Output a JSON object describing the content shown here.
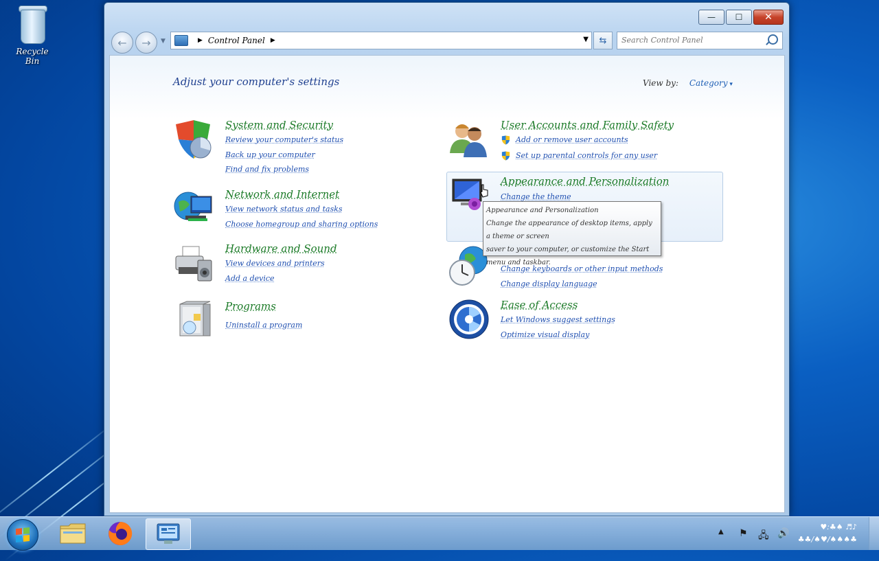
{
  "desktop": {
    "recycle_bin_label": "Recycle Bin"
  },
  "window": {
    "buttons": {
      "minimize": "—",
      "maximize": "☐",
      "close": "✕"
    },
    "address": {
      "crumb": "Control Panel"
    },
    "search": {
      "placeholder": "Search Control Panel"
    }
  },
  "content": {
    "heading": "Adjust your computer's settings",
    "view_by_label": "View by:",
    "view_by_value": "Category"
  },
  "categories": {
    "system": {
      "title": "System and Security",
      "links": [
        "Review your computer's status",
        "Back up your computer",
        "Find and fix problems"
      ]
    },
    "network": {
      "title": "Network and Internet",
      "links": [
        "View network status and tasks",
        "Choose homegroup and sharing options"
      ]
    },
    "hardware": {
      "title": "Hardware and Sound",
      "links": [
        "View devices and printers",
        "Add a device"
      ]
    },
    "programs": {
      "title": "Programs",
      "links": [
        "Uninstall a program"
      ]
    },
    "users": {
      "title": "User Accounts and Family Safety",
      "links": [
        "Add or remove user accounts",
        "Set up parental controls for any user"
      ]
    },
    "appearance": {
      "title": "Appearance and Personalization",
      "links": [
        "Change the theme"
      ]
    },
    "clock": {
      "links": [
        "Change keyboards or other input methods",
        "Change display language"
      ]
    },
    "ease": {
      "title": "Ease of Access",
      "links": [
        "Let Windows suggest settings",
        "Optimize visual display"
      ]
    }
  },
  "tooltip": {
    "title": "Appearance and Personalization",
    "line1": "Change the appearance of desktop items, apply a theme or screen",
    "line2": "saver to your computer, or customize the Start menu and taskbar."
  },
  "taskbar": {
    "items": [
      "start",
      "explorer",
      "firefox",
      "control-panel"
    ],
    "tray_icons": [
      "show-hidden-icons",
      "action-center-icon",
      "network-icon",
      "volume-icon"
    ],
    "clock_time": "♥:♣♠ ♬♪",
    "clock_date": "♣♣/♠♥/♠♠♠♣"
  }
}
